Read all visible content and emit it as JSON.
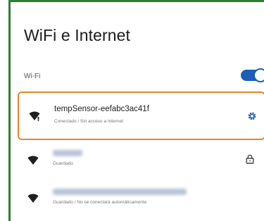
{
  "header": {
    "title": "WiFi e Internet"
  },
  "wifi_section": {
    "label": "Wi-Fi",
    "toggle_on": true
  },
  "networks": [
    {
      "ssid": "tempSensor-eefabc3ac41f",
      "status": "Conectado / Sin acceso a Internet",
      "icon": "wifi-exclamation-icon",
      "action_icon": "gear-icon",
      "selected": true
    },
    {
      "ssid": "",
      "status": "Guardado",
      "icon": "wifi-icon",
      "action_icon": "lock-icon",
      "selected": false
    },
    {
      "ssid": "",
      "status": "Guardado / No se conectará automáticamente",
      "icon": "wifi-icon",
      "action_icon": "",
      "selected": false
    }
  ],
  "colors": {
    "accent": "#1a5fb4",
    "selection_border": "#e3862b",
    "frame_border": "#2f7d32"
  }
}
